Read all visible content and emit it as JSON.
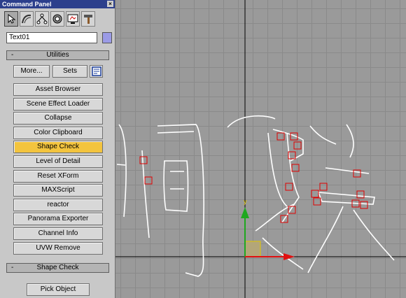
{
  "panel": {
    "title": "Command Panel",
    "close_glyph": "×",
    "tabs": [
      {
        "icon": "create-arrow-icon"
      },
      {
        "icon": "modify-curve-icon"
      },
      {
        "icon": "hierarchy-icon"
      },
      {
        "icon": "motion-icon"
      },
      {
        "icon": "display-monitor-icon"
      },
      {
        "icon": "utilities-hammer-icon"
      }
    ],
    "object_name": "Text01",
    "object_color": "#9b9be6"
  },
  "utilities": {
    "rollout_title": "Utilities",
    "collapse_glyph": "-",
    "more_label": "More...",
    "sets_label": "Sets",
    "items": [
      "Asset Browser",
      "Scene Effect Loader",
      "Collapse",
      "Color Clipboard",
      "Shape Check",
      "Level of Detail",
      "Reset XForm",
      "MAXScript",
      "reactor",
      "Panorama Exporter",
      "Channel Info",
      "UVW Remove"
    ],
    "active_item": "Shape Check"
  },
  "shape_check": {
    "rollout_title": "Shape Check",
    "collapse_glyph": "-",
    "pick_label": "Pick Object"
  },
  "viewport": {
    "axis_y_color": "#1fa81f",
    "axis_x_color": "#e01010",
    "axis_label": "y"
  }
}
